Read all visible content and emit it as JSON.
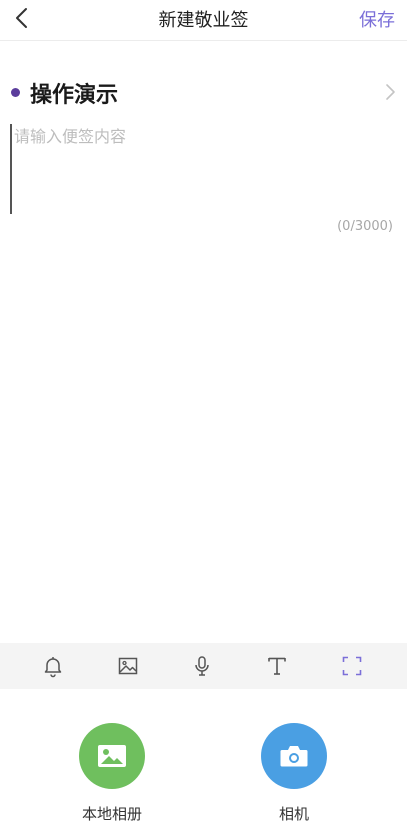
{
  "header": {
    "back_icon": "chevron-left-icon",
    "title": "新建敬业签",
    "save_label": "保存"
  },
  "category": {
    "label": "操作演示",
    "dot_color": "#5b3d9c",
    "chevron_icon": "chevron-right-icon"
  },
  "note": {
    "placeholder": "请输入便签内容",
    "value": "",
    "char_count": "(0/3000)"
  },
  "toolbar": {
    "items": [
      {
        "icon": "bell-icon"
      },
      {
        "icon": "image-icon"
      },
      {
        "icon": "microphone-icon"
      },
      {
        "icon": "text-format-icon"
      },
      {
        "icon": "scan-frame-icon",
        "active": true
      }
    ],
    "background": "#f4f4f4",
    "active_color": "#7b6fd8"
  },
  "media_picker": {
    "options": [
      {
        "label": "本地相册",
        "icon": "gallery-icon",
        "color": "#6fbf5e"
      },
      {
        "label": "相机",
        "icon": "camera-icon",
        "color": "#4a9fe3"
      }
    ]
  },
  "colors": {
    "accent": "#7b6fd8",
    "text": "#222222",
    "placeholder": "#bdbdbd"
  }
}
